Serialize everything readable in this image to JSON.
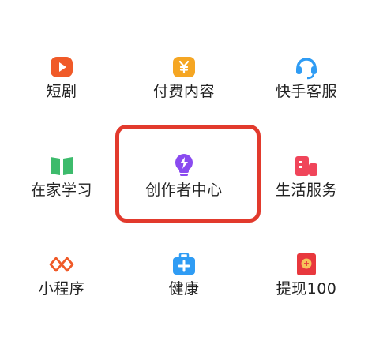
{
  "top_row_partial": [
    "...",
    "...",
    "..."
  ],
  "grid": [
    {
      "label": "短剧",
      "icon": "play-icon",
      "color": "#f05a28"
    },
    {
      "label": "付费内容",
      "icon": "yuan-icon",
      "color": "#f5a623"
    },
    {
      "label": "快手客服",
      "icon": "headset-icon",
      "color": "#2f9cf4"
    },
    {
      "label": "在家学习",
      "icon": "book-icon",
      "color": "#3dbb6c"
    },
    {
      "label": "创作者中心",
      "icon": "lightbulb-icon",
      "color": "#8a4bf0"
    },
    {
      "label": "生活服务",
      "icon": "building-icon",
      "color": "#f0455a"
    },
    {
      "label": "小程序",
      "icon": "mini-program-icon",
      "color": "#f05a28"
    },
    {
      "label": "健康",
      "icon": "medical-kit-icon",
      "color": "#2f9cf4"
    },
    {
      "label": "提现100",
      "icon": "red-envelope-icon",
      "color": "#e8383d"
    }
  ],
  "highlight_color": "#e23a2d"
}
